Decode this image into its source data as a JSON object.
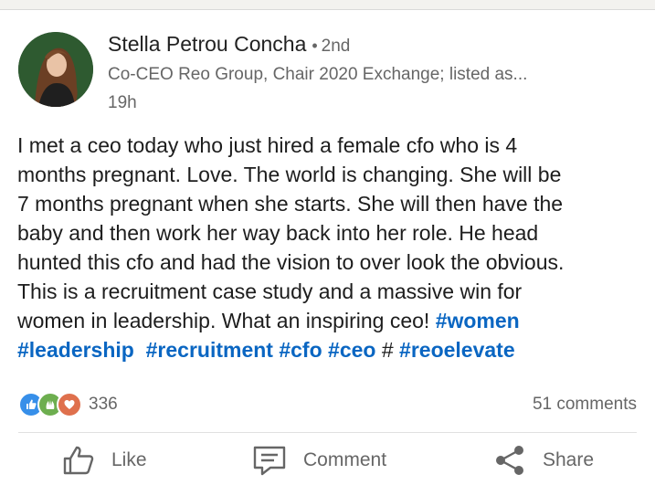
{
  "post": {
    "author": {
      "name": "Stella Petrou Concha",
      "separator": "•",
      "degree": "2nd",
      "headline": "Co-CEO Reo Group, Chair 2020 Exchange; listed as...",
      "time": "19h"
    },
    "text_lines": [
      "I met a ceo today who just hired a female cfo who is 4",
      "months pregnant. Love. The world is changing. She will be",
      "7 months pregnant when she starts. She will then have the",
      "baby and then work her way back into her role. He head",
      "hunted this cfo and had the vision to over look the obvious.",
      "This is a recruitment case study and a massive win for",
      "women in leadership. What an inspiring ceo! "
    ],
    "hashtags": {
      "women": "#women",
      "leadership": "#leadership",
      "recruitment": "#recruitment",
      "cfo": "#cfo",
      "ceo": "#ceo",
      "hash": "#",
      "reoelevate": "#reoelevate"
    },
    "reaction_icons": [
      "like-icon",
      "celebrate-icon",
      "love-icon"
    ],
    "reaction_count": "336",
    "comment_count": "51 comments"
  },
  "actions": {
    "like": "Like",
    "comment": "Comment",
    "share": "Share"
  },
  "colors": {
    "link": "#0a66c2",
    "like": "#378fe9",
    "celebrate": "#6dae4f",
    "love": "#df704d"
  }
}
